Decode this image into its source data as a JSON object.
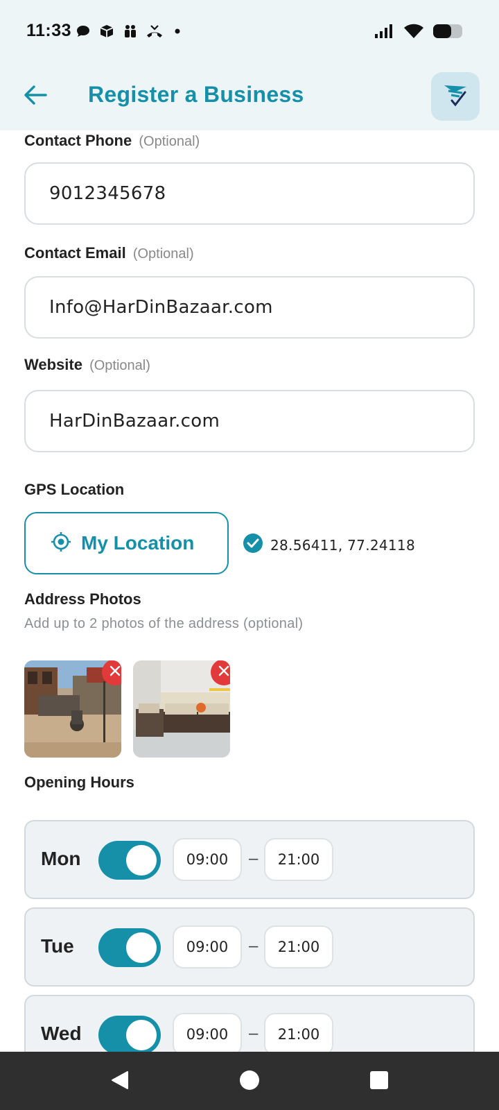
{
  "status_bar": {
    "time": "11:33",
    "notification_icons": [
      "chat-icon",
      "box-icon",
      "people-icon",
      "missed-call-icon",
      "dot-icon"
    ],
    "system_icons": [
      "signal-icon",
      "wifi-icon",
      "battery-icon"
    ]
  },
  "app_bar": {
    "title": "Register a Business",
    "back_icon": "arrow-left-icon",
    "action_icon": "send-check-logo-icon"
  },
  "form": {
    "contact_phone": {
      "label": "Contact Phone",
      "optional": "(Optional)",
      "value": "9012345678"
    },
    "contact_email": {
      "label": "Contact Email",
      "optional": "(Optional)",
      "value": "Info@HarDinBazaar.com"
    },
    "website": {
      "label": "Website",
      "optional": "(Optional)",
      "value": "HarDinBazaar.com"
    },
    "gps": {
      "label": "GPS Location",
      "button_label": "My Location",
      "coordinates": "28.56411, 77.24118"
    },
    "photos": {
      "label": "Address Photos",
      "hint": "Add up to 2 photos of the address (optional)"
    },
    "hours": {
      "label": "Opening Hours",
      "separator": "–",
      "days": [
        {
          "name": "Mon",
          "open": "09:00",
          "close": "21:00",
          "enabled": true
        },
        {
          "name": "Tue",
          "open": "09:00",
          "close": "21:00",
          "enabled": true
        },
        {
          "name": "Wed",
          "open": "09:00",
          "close": "21:00",
          "enabled": true
        }
      ]
    }
  },
  "colors": {
    "accent": "#1590a8",
    "danger": "#e23a3a",
    "appbar_bg": "#eef5f7"
  }
}
